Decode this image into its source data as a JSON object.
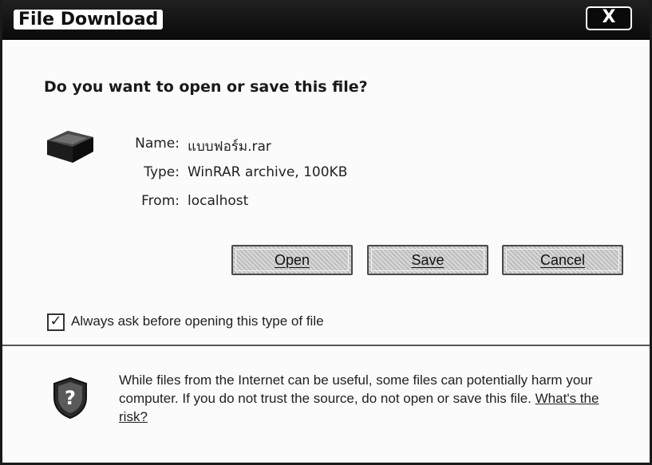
{
  "window": {
    "title": "File Download",
    "close_label": "X"
  },
  "dialog": {
    "question": "Do you want to open or save this file?",
    "file": {
      "name_label": "Name:",
      "name_value": "แบบฟอร์ม.rar",
      "type_label": "Type:",
      "type_value": "WinRAR archive, 100KB",
      "from_label": "From:",
      "from_value": "localhost",
      "icon": "rar-archive-icon"
    },
    "buttons": {
      "open": "Open",
      "save": "Save",
      "cancel": "Cancel"
    },
    "always_ask": {
      "label": "Always ask before opening this type of file",
      "checked": true,
      "check_glyph": "✓"
    },
    "warning": {
      "icon": "shield-question-icon",
      "text": "While files from the Internet can be useful, some files can potentially harm your computer. If you do not trust the source, do not open or save this file. ",
      "link": "What's the risk?"
    }
  }
}
